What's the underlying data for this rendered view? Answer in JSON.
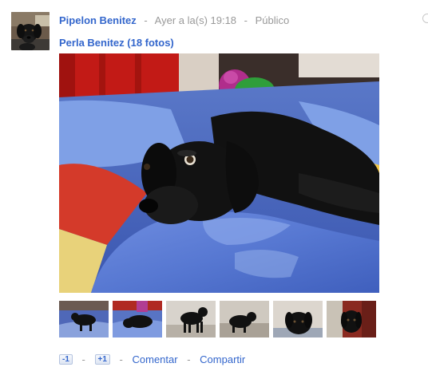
{
  "post": {
    "author": "Pipelon Benitez",
    "timestamp": "Ayer a la(s) 19:18",
    "visibility": "Público",
    "separator": "-"
  },
  "album": {
    "title": "Perla Benitez (18 fotos)",
    "main_photo": "black-puppy-on-bed-photo",
    "thumbnails": [
      "puppy-thumbnail-1",
      "puppy-thumbnail-2",
      "puppy-thumbnail-3",
      "puppy-thumbnail-4",
      "puppy-thumbnail-5",
      "puppy-thumbnail-6"
    ]
  },
  "actions": {
    "minus_one": "-1",
    "plus_one": "+1",
    "comment": "Comentar",
    "share": "Compartir",
    "separator": "-"
  },
  "colors": {
    "link": "#3366cc",
    "meta": "#999999"
  }
}
